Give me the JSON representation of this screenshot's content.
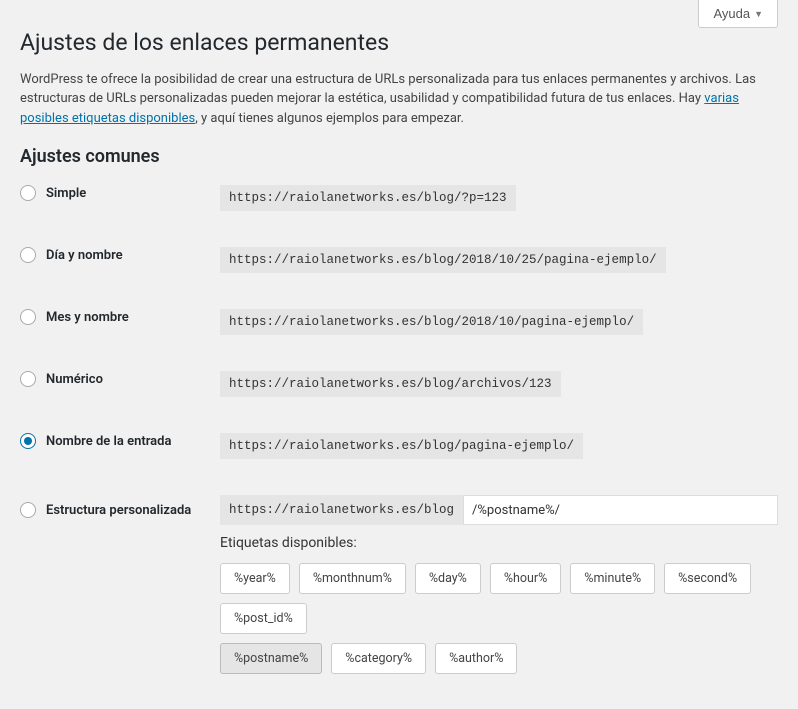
{
  "help_label": "Ayuda",
  "page_title": "Ajustes de los enlaces permanentes",
  "description_pre": "WordPress te ofrece la posibilidad de crear una estructura de URLs personalizada para tus enlaces permanentes y archivos. Las estructuras de URLs personalizadas pueden mejorar la estética, usabilidad y compatibilidad futura de tus enlaces. Hay ",
  "description_link": "varias posibles etiquetas disponibles",
  "description_post": ", y aquí tienes algunos ejemplos para empezar.",
  "section_title": "Ajustes comunes",
  "options": {
    "simple": {
      "label": "Simple",
      "example": "https://raiolanetworks.es/blog/?p=123"
    },
    "day_name": {
      "label": "Día y nombre",
      "example": "https://raiolanetworks.es/blog/2018/10/25/pagina-ejemplo/"
    },
    "month_name": {
      "label": "Mes y nombre",
      "example": "https://raiolanetworks.es/blog/2018/10/pagina-ejemplo/"
    },
    "numeric": {
      "label": "Numérico",
      "example": "https://raiolanetworks.es/blog/archivos/123"
    },
    "postname": {
      "label": "Nombre de la entrada",
      "example": "https://raiolanetworks.es/blog/pagina-ejemplo/"
    },
    "custom": {
      "label": "Estructura personalizada",
      "prefix": "https://raiolanetworks.es/blog",
      "value": "/%postname%/"
    }
  },
  "tags_label": "Etiquetas disponibles:",
  "tags": {
    "year": "%year%",
    "monthnum": "%monthnum%",
    "day": "%day%",
    "hour": "%hour%",
    "minute": "%minute%",
    "second": "%second%",
    "post_id": "%post_id%",
    "postname": "%postname%",
    "category": "%category%",
    "author": "%author%"
  }
}
